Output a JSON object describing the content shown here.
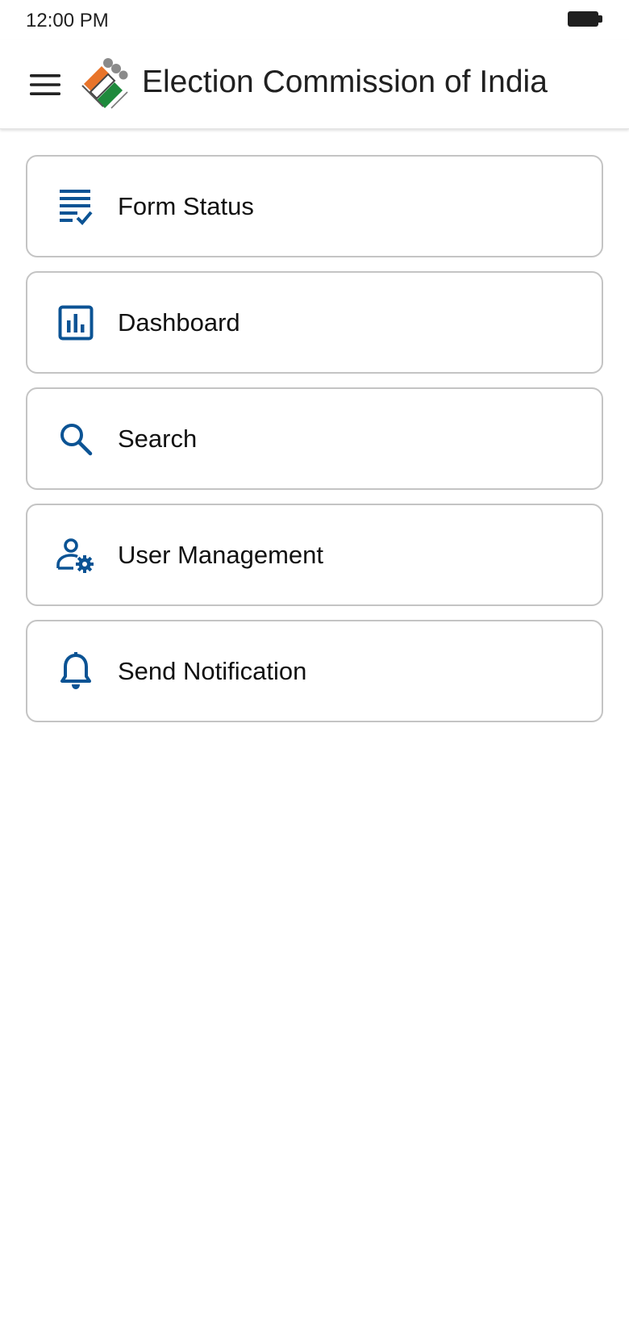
{
  "status_bar": {
    "time": "12:00 PM",
    "battery_icon": "battery-full-icon"
  },
  "app_bar": {
    "title": "Election Commission of India",
    "menu_icon": "hamburger-menu-icon",
    "logo_icon": "eci-logo-icon"
  },
  "colors": {
    "icon_blue": "#0b5394",
    "card_border": "#c4c4c4",
    "text": "#111111",
    "logo_orange": "#e8742a",
    "logo_green": "#1e8a3c"
  },
  "menu": {
    "items": [
      {
        "label": "Form Status",
        "icon": "form-checklist-icon"
      },
      {
        "label": "Dashboard",
        "icon": "bar-chart-icon"
      },
      {
        "label": "Search",
        "icon": "search-icon"
      },
      {
        "label": "User Management",
        "icon": "user-settings-icon"
      },
      {
        "label": "Send Notification",
        "icon": "bell-icon"
      }
    ]
  }
}
